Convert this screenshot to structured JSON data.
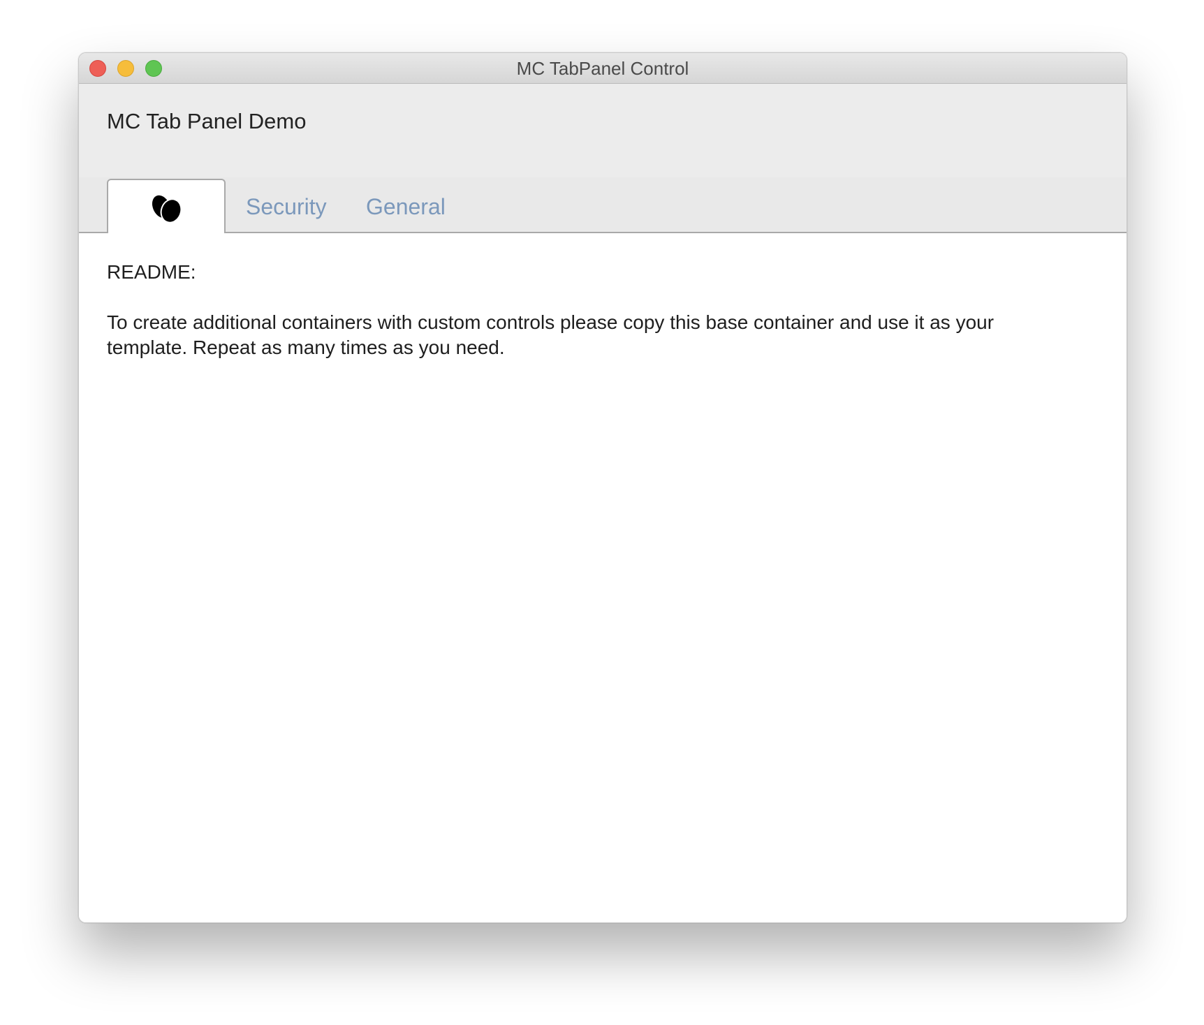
{
  "window": {
    "title": "MC TabPanel Control"
  },
  "header": {
    "title": "MC Tab Panel Demo"
  },
  "tabs": [
    {
      "icon": "eggs-icon",
      "label": "",
      "active": true
    },
    {
      "label": "Security",
      "active": false
    },
    {
      "label": "General",
      "active": false
    }
  ],
  "content": {
    "readme_label": "README:",
    "readme_text": "To create additional containers with custom controls please copy this base container and use it as your template. Repeat as many times as you need."
  },
  "colors": {
    "tab_inactive_text": "#7b98bb",
    "close": "#ee5f57",
    "minimize": "#f6bd3b",
    "maximize": "#5fc553"
  }
}
